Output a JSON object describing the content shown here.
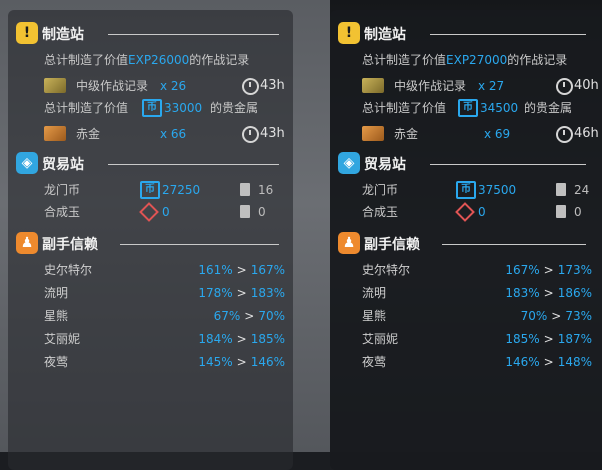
{
  "colors": {
    "accent_blue": "#2aa8ee",
    "factory_icon": "#f2c232",
    "trade_icon": "#31a6e0",
    "assist_icon": "#ee8a2e"
  },
  "panels": [
    {
      "factory": {
        "title": "制造站",
        "summary1_prefix": "总计制造了价值",
        "summary1_value": "EXP26000",
        "summary1_suffix": "的作战记录",
        "record_label": "中级作战记录",
        "record_count": "x 26",
        "record_time": "43h",
        "summary2_prefix": "总计制造了价值",
        "summary2_value": "33000",
        "summary2_suffix": "的贵金属",
        "gold_label": "赤金",
        "gold_count": "x 66",
        "gold_time": "43h"
      },
      "trade": {
        "title": "贸易站",
        "lmd_label": "龙门币",
        "lmd_value": "27250",
        "lmd_orders": "16",
        "orundum_label": "合成玉",
        "orundum_value": "0",
        "orundum_orders": "0"
      },
      "assist": {
        "title": "副手信赖",
        "rows": [
          {
            "name": "史尔特尔",
            "from": "161%",
            "to": "167%"
          },
          {
            "name": "流明",
            "from": "178%",
            "to": "183%"
          },
          {
            "name": "星熊",
            "from": "67%",
            "to": "70%"
          },
          {
            "name": "艾丽妮",
            "from": "184%",
            "to": "185%"
          },
          {
            "name": "夜莺",
            "from": "145%",
            "to": "146%"
          }
        ]
      }
    },
    {
      "factory": {
        "title": "制造站",
        "summary1_prefix": "总计制造了价值",
        "summary1_value": "EXP27000",
        "summary1_suffix": "的作战记录",
        "record_label": "中级作战记录",
        "record_count": "x 27",
        "record_time": "40h",
        "summary2_prefix": "总计制造了价值",
        "summary2_value": "34500",
        "summary2_suffix": "的贵金属",
        "gold_label": "赤金",
        "gold_count": "x 69",
        "gold_time": "46h"
      },
      "trade": {
        "title": "贸易站",
        "lmd_label": "龙门币",
        "lmd_value": "37500",
        "lmd_orders": "24",
        "orundum_label": "合成玉",
        "orundum_value": "0",
        "orundum_orders": "0"
      },
      "assist": {
        "title": "副手信赖",
        "rows": [
          {
            "name": "史尔特尔",
            "from": "167%",
            "to": "173%"
          },
          {
            "name": "流明",
            "from": "183%",
            "to": "186%"
          },
          {
            "name": "星熊",
            "from": "70%",
            "to": "73%"
          },
          {
            "name": "艾丽妮",
            "from": "185%",
            "to": "187%"
          },
          {
            "name": "夜莺",
            "from": "146%",
            "to": "148%"
          }
        ]
      }
    }
  ]
}
